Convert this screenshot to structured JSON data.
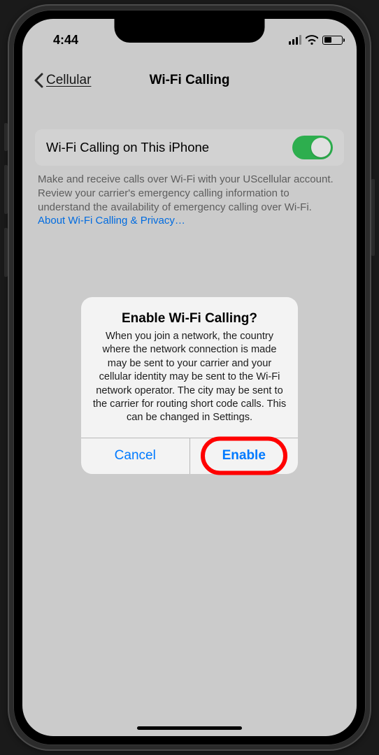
{
  "status": {
    "time": "4:44"
  },
  "nav": {
    "back_label": "Cellular",
    "title": "Wi-Fi Calling"
  },
  "setting_row": {
    "label": "Wi-Fi Calling on This iPhone"
  },
  "footer": {
    "text": "Make and receive calls over Wi-Fi with your UScellular account. Review your carrier's emergency calling information to understand the availability of emergency calling over Wi-Fi. ",
    "link": "About Wi-Fi Calling & Privacy…"
  },
  "alert": {
    "title": "Enable Wi-Fi Calling?",
    "message": "When you join a network, the country where the network connection is made may be sent to your carrier and your cellular identity may be sent to the Wi-Fi network operator. The city may be sent to the carrier for routing short code calls. This can be changed in Settings.",
    "cancel": "Cancel",
    "confirm": "Enable"
  }
}
